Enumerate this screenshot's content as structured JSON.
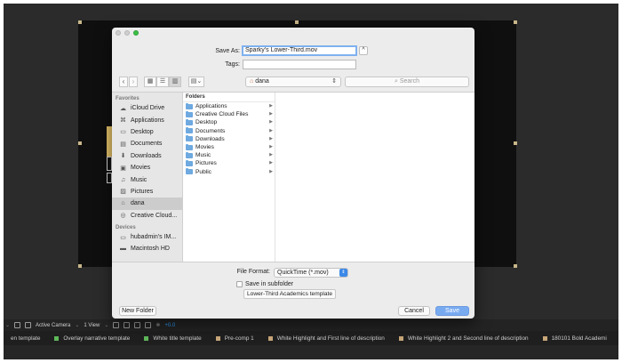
{
  "background_app": {
    "toolbar": {
      "camera_label": "Active Camera",
      "view_label": "1 View",
      "offset_label": "+0.0"
    },
    "timeline_tabs": [
      {
        "label": "en template",
        "color": "#d0d0d0"
      },
      {
        "label": "Overlay narrative template",
        "color": "#5fb85a"
      },
      {
        "label": "White title template",
        "color": "#5fb85a"
      },
      {
        "label": "Pre-comp 1",
        "color": "#c9a77a"
      },
      {
        "label": "White Highlight and First line of description",
        "color": "#c9a77a"
      },
      {
        "label": "White Highlight 2 and Second line of description",
        "color": "#c9a77a"
      },
      {
        "label": "180101 Bold Academi",
        "color": "#c9a77a"
      }
    ]
  },
  "dialog": {
    "save_as_label": "Save As:",
    "save_as_value": "Sparky's Lower-Third.mov",
    "tags_label": "Tags:",
    "tags_value": "",
    "collapse_glyph": "^",
    "location": "dana",
    "search_placeholder": "Search",
    "sidebar": {
      "favorites_header": "Favorites",
      "favorites": [
        {
          "label": "iCloud Drive",
          "icon": "cloud-icon"
        },
        {
          "label": "Applications",
          "icon": "applications-icon"
        },
        {
          "label": "Desktop",
          "icon": "desktop-icon"
        },
        {
          "label": "Documents",
          "icon": "documents-icon"
        },
        {
          "label": "Downloads",
          "icon": "downloads-icon"
        },
        {
          "label": "Movies",
          "icon": "movies-icon"
        },
        {
          "label": "Music",
          "icon": "music-icon"
        },
        {
          "label": "Pictures",
          "icon": "pictures-icon"
        },
        {
          "label": "dana",
          "icon": "home-icon",
          "selected": true
        },
        {
          "label": "Creative Cloud...",
          "icon": "creative-cloud-icon"
        }
      ],
      "devices_header": "Devices",
      "devices": [
        {
          "label": "hubadmin's IM...",
          "icon": "computer-icon"
        },
        {
          "label": "Macintosh HD",
          "icon": "disk-icon"
        }
      ]
    },
    "column_header": "Folders",
    "folders": [
      "Applications",
      "Creative Cloud Files",
      "Desktop",
      "Documents",
      "Downloads",
      "Movies",
      "Music",
      "Pictures",
      "Public"
    ],
    "file_format_label": "File Format:",
    "file_format_value": "QuickTime (*.mov)",
    "subfolder_label": "Save in subfolder",
    "template_button": "Lower-Third Academics template",
    "new_folder_button": "New Folder",
    "cancel_button": "Cancel",
    "save_button": "Save"
  }
}
